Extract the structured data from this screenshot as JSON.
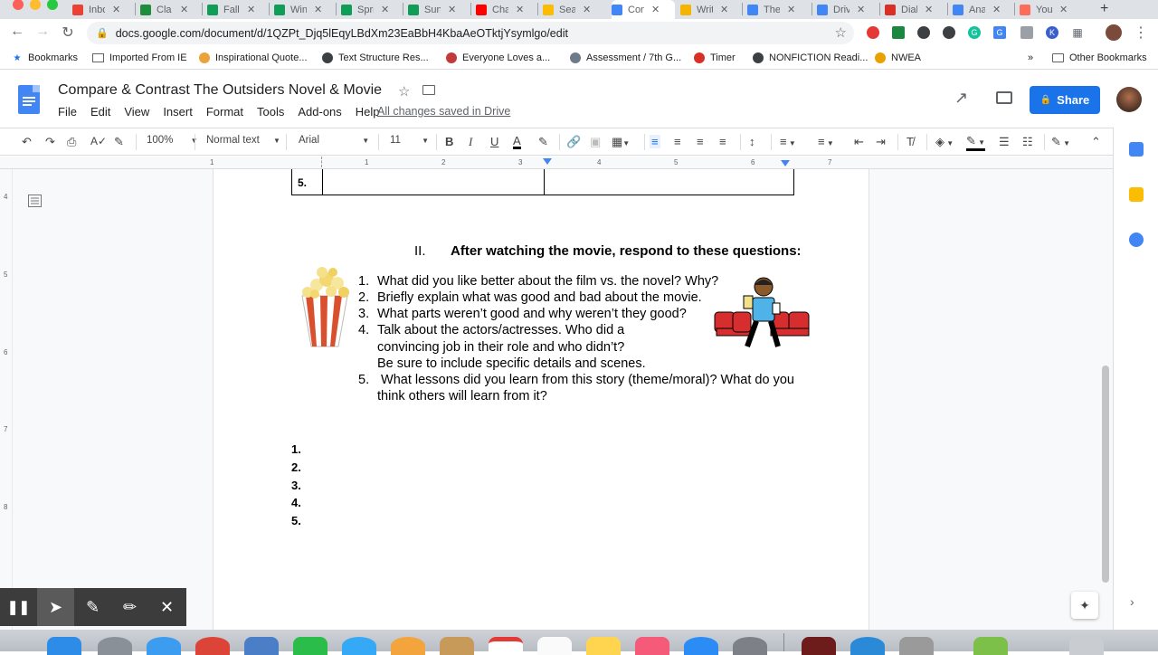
{
  "browser": {
    "tabs": [
      {
        "label": "Inbo",
        "icon": "gmail-icon",
        "color": "#ea4335"
      },
      {
        "label": "Cla",
        "icon": "classroom-icon",
        "color": "#1e8e3e"
      },
      {
        "label": "Fall",
        "icon": "sheets-icon",
        "color": "#0f9d58"
      },
      {
        "label": "Win",
        "icon": "sheets-icon",
        "color": "#0f9d58"
      },
      {
        "label": "Spri",
        "icon": "sheets-icon",
        "color": "#0f9d58"
      },
      {
        "label": "Sun",
        "icon": "sheets-icon",
        "color": "#0f9d58"
      },
      {
        "label": "Cha",
        "icon": "youtube-icon",
        "color": "#ff0000"
      },
      {
        "label": "Sea",
        "icon": "drive-icon",
        "color": "#fbbc04"
      },
      {
        "label": "Con",
        "icon": "docs-icon",
        "color": "#4285f4",
        "active": true
      },
      {
        "label": "Writ",
        "icon": "slides-icon",
        "color": "#f4b400"
      },
      {
        "label": "The",
        "icon": "docs-icon",
        "color": "#4285f4"
      },
      {
        "label": "Driv",
        "icon": "docs-icon",
        "color": "#4285f4"
      },
      {
        "label": "Dial",
        "icon": "pdf-icon",
        "color": "#d93025"
      },
      {
        "label": "Ana",
        "icon": "docs-icon",
        "color": "#4285f4"
      },
      {
        "label": "You",
        "icon": "youtube-icon",
        "color": "#ff6d5a"
      }
    ],
    "new_tab": "+",
    "url": "docs.google.com/document/d/1QZPt_Djq5lEqyLBdXm23EaBbH4KbaAeOTktjYsymlgo/edit",
    "bookmarks": [
      {
        "label": "Bookmarks",
        "icon": "star-icon"
      },
      {
        "label": "Imported From IE",
        "icon": "folder-icon"
      },
      {
        "label": "Inspirational Quote...",
        "icon": "site-icon"
      },
      {
        "label": "Text Structure Res...",
        "icon": "site-icon"
      },
      {
        "label": "Everyone Loves a...",
        "icon": "site-icon"
      },
      {
        "label": "Assessment / 7th G...",
        "icon": "site-icon"
      },
      {
        "label": "Timer",
        "icon": "site-icon"
      },
      {
        "label": "NONFICTION Readi...",
        "icon": "site-icon"
      },
      {
        "label": "NWEA",
        "icon": "site-icon"
      }
    ],
    "bookmarks_more": "»",
    "other_bookmarks": "Other Bookmarks"
  },
  "docs": {
    "title": "Compare & Contrast The Outsiders Novel & Movie",
    "menu": [
      "File",
      "Edit",
      "View",
      "Insert",
      "Format",
      "Tools",
      "Add-ons",
      "Help"
    ],
    "save_status": "All changes saved in Drive",
    "share_label": "Share",
    "zoom": "100%",
    "style": "Normal text",
    "font": "Arial",
    "font_size": "11"
  },
  "document": {
    "table_row_number": "5.",
    "section_number": "II.",
    "section_title": "After watching the movie, respond to these questions:",
    "questions": [
      {
        "num": "1.",
        "text": "What did you like better about the film vs. the novel? Why?"
      },
      {
        "num": "2.",
        "text": "Briefly explain what was good and bad about the movie."
      },
      {
        "num": "3.",
        "text": "What parts weren’t good and why weren’t they good?"
      },
      {
        "num": "4.",
        "text": "Talk about the actors/actresses.  Who did a"
      }
    ],
    "q4_cont1": "convincing job in their role and who didn’t?",
    "q4_cont2": "Be sure to include specific details and scenes.",
    "q5_num": "5.",
    "q5_text": " What lessons did you learn from this story (theme/moral)? What do you",
    "q5_cont": "think others will learn from it?",
    "answers": [
      "1.",
      "2.",
      "3.",
      "4.",
      "5."
    ]
  },
  "ruler_h": [
    "1",
    "1",
    "2",
    "3",
    "4",
    "5",
    "6",
    "7"
  ],
  "ruler_v": [
    "4",
    "5",
    "6",
    "7",
    "8"
  ]
}
